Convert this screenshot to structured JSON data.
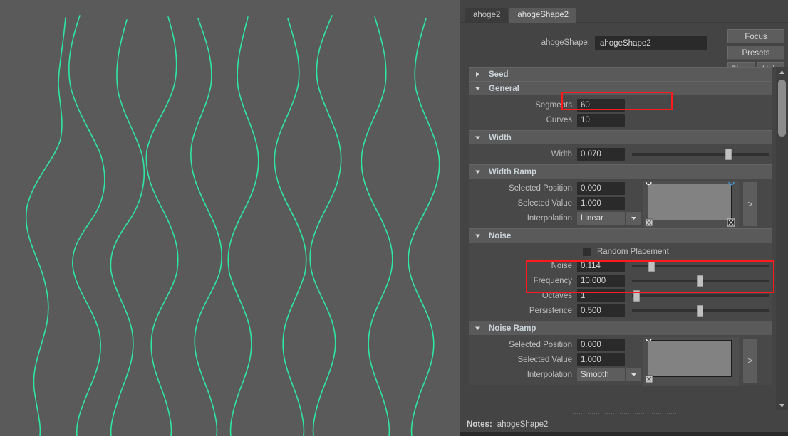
{
  "viewport": {
    "name": "maya-viewport",
    "background_color": "#5a5a5a",
    "curve_color": "#2fe5a2",
    "curve_count": 10,
    "description": "10 vertical wavy noise curves"
  },
  "attribute_editor": {
    "tabs": [
      {
        "label": "ahoge2",
        "active": false
      },
      {
        "label": "ahogeShape2",
        "active": true
      }
    ],
    "name_row": {
      "label": "ahogeShape:",
      "value": "ahogeShape2",
      "icon_load": "load-attributes-icon",
      "icon_copy": "copy-tab-icon"
    },
    "buttons": {
      "focus": "Focus",
      "presets": "Presets",
      "show": "Show",
      "hide": "Hide"
    },
    "sections": [
      {
        "name": "seed",
        "title": "Seed",
        "expanded": false,
        "rows": []
      },
      {
        "name": "general",
        "title": "General",
        "expanded": true,
        "rows": [
          {
            "label": "Segments",
            "value": "60",
            "type": "field",
            "highlight": true
          },
          {
            "label": "Curves",
            "value": "10",
            "type": "field"
          }
        ]
      },
      {
        "name": "width",
        "title": "Width",
        "expanded": true,
        "rows": [
          {
            "label": "Width",
            "value": "0.070",
            "type": "slider",
            "slider_pct": 70
          }
        ]
      },
      {
        "name": "width-ramp",
        "title": "Width Ramp",
        "expanded": true,
        "rows": [
          {
            "label": "Selected Position",
            "value": "0.000",
            "type": "field"
          },
          {
            "label": "Selected Value",
            "value": "1.000",
            "type": "field"
          },
          {
            "label": "Interpolation",
            "value": "Linear",
            "type": "combo"
          }
        ],
        "ramp": {
          "expand_label": ">",
          "markers": 2
        }
      },
      {
        "name": "noise",
        "title": "Noise",
        "expanded": true,
        "checkbox": {
          "label": "Random Placement",
          "checked": false
        },
        "rows": [
          {
            "label": "Noise",
            "value": "0.114",
            "type": "slider",
            "slider_pct": 13,
            "highlight": true
          },
          {
            "label": "Frequency",
            "value": "10.000",
            "type": "slider",
            "slider_pct": 48,
            "highlight": true
          },
          {
            "label": "Octaves",
            "value": "1",
            "type": "slider",
            "slider_pct": 2
          },
          {
            "label": "Persistence",
            "value": "0.500",
            "type": "slider",
            "slider_pct": 48
          }
        ]
      },
      {
        "name": "noise-ramp",
        "title": "Noise Ramp",
        "expanded": true,
        "rows": [
          {
            "label": "Selected Position",
            "value": "0.000",
            "type": "field"
          },
          {
            "label": "Selected Value",
            "value": "1.000",
            "type": "field"
          },
          {
            "label": "Interpolation",
            "value": "Smooth",
            "type": "combo"
          }
        ],
        "ramp": {
          "expand_label": ">",
          "markers": 1
        }
      }
    ],
    "notes": {
      "label": "Notes:",
      "value": "ahogeShape2"
    },
    "scrollbar": {
      "up_icon": "scroll-up-arrow",
      "down_icon": "scroll-down-arrow"
    }
  },
  "highlight_color": "#ff1b1b"
}
